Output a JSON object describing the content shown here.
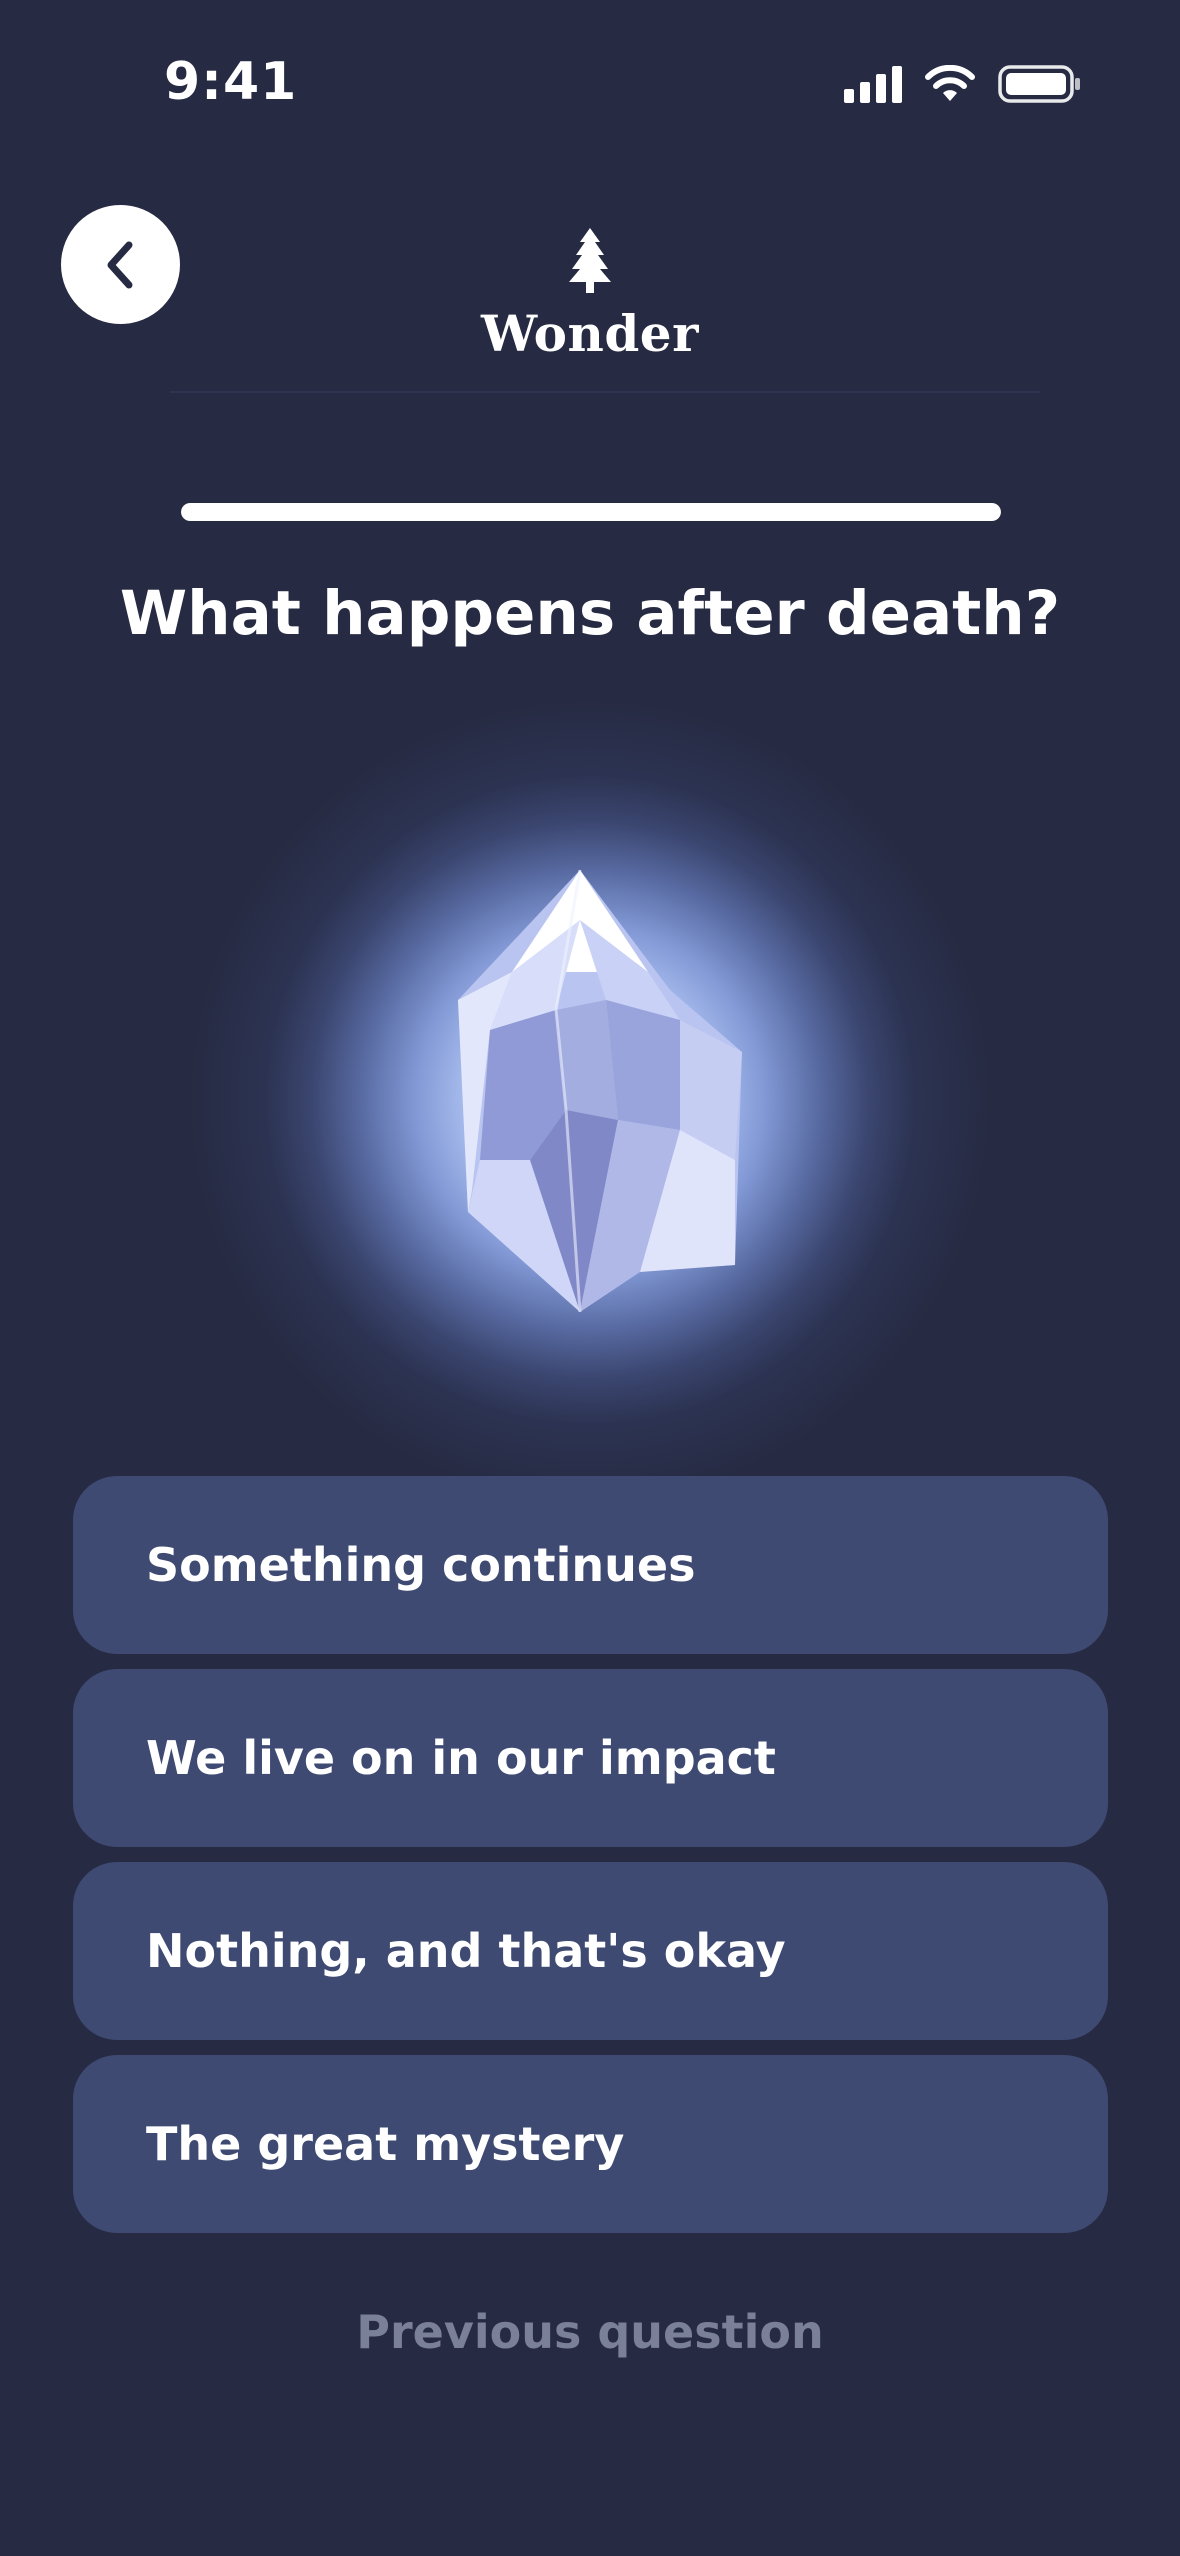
{
  "status_bar": {
    "time": "9:41",
    "icons": [
      "signal-icon",
      "wifi-icon",
      "battery-icon"
    ]
  },
  "header": {
    "back_icon": "chevron-left-icon",
    "brand_icon": "tree-icon",
    "brand_name": "Wonder"
  },
  "progress": {
    "fraction": 1.0
  },
  "question": {
    "title": "What happens after death?",
    "illustration": "crystal-icon"
  },
  "answers": [
    {
      "label": "Something continues"
    },
    {
      "label": "We live on in our impact"
    },
    {
      "label": "Nothing, and that's okay"
    },
    {
      "label": "The great mystery"
    }
  ],
  "footer": {
    "previous_label": "Previous question"
  },
  "colors": {
    "background": "#262a42",
    "answer_background": "#3e4a72",
    "muted_text": "#7b8099",
    "accent_glow": "#b6c9f5"
  }
}
